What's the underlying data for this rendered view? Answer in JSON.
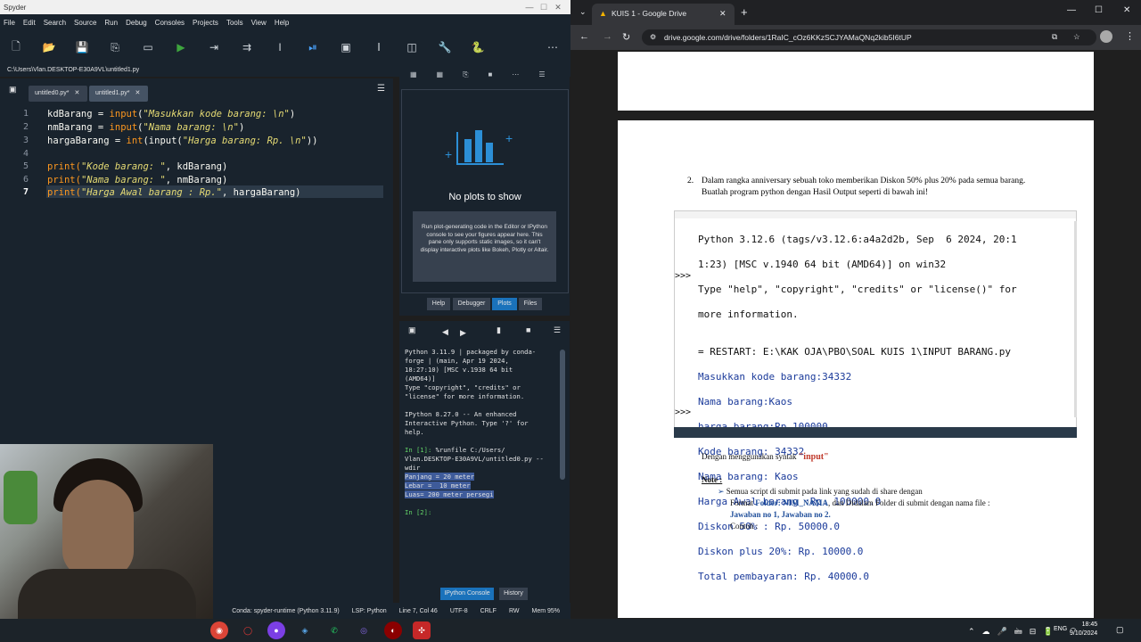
{
  "spyder": {
    "title": "Spyder",
    "window_controls": [
      "—",
      "☐",
      "✕"
    ],
    "menu": [
      "File",
      "Edit",
      "Search",
      "Source",
      "Run",
      "Debug",
      "Consoles",
      "Projects",
      "Tools",
      "View",
      "Help"
    ],
    "path": "C:\\Users\\Vlan.DESKTOP-E30A9VL\\untitled1.py",
    "tabs": [
      "untitled0.py*",
      "untitled1.py*"
    ],
    "line_numbers": [
      "1",
      "2",
      "3",
      "4",
      "5",
      "6",
      "7"
    ],
    "code": {
      "l1_a": "kdBarang = ",
      "l1_fn": "input",
      "l1_b": "(",
      "l1_str": "\"Masukkan kode barang: \\n\"",
      "l1_c": ")",
      "l2_a": "nmBarang = ",
      "l2_fn": "input",
      "l2_b": "(",
      "l2_str": "\"Nama barang: \\n\"",
      "l2_c": ")",
      "l3_a": "hargaBarang = ",
      "l3_fn": "int",
      "l3_b": "(input(",
      "l3_str": "\"Harga barang: Rp. \\n\"",
      "l3_c": "))",
      "l5_a": "print(",
      "l5_str": "\"Kode barang: \"",
      "l5_b": ", kdBarang)",
      "l6_a": "print(",
      "l6_str": "\"Nama barang: \"",
      "l6_b": ", nmBarang)",
      "l7_a": "print(",
      "l7_str": "\"Harga Awal barang : Rp.\"",
      "l7_b": ", hargaBarang)"
    },
    "plots": {
      "no_plots": "No plots to show",
      "info": "Run plot-generating code in the Editor or IPython console to see your figures appear here. This pane only supports static images, so it can't display interactive plots like Bokeh, Plotly or Altair.",
      "tabs": [
        "Help",
        "Debugger",
        "Plots",
        "Files"
      ]
    },
    "console": {
      "banner": "Python 3.11.9 | packaged by conda-\nforge | (main, Apr 19 2024,\n18:27:10) [MSC v.1938 64 bit\n(AMD64)]\nType \"copyright\", \"credits\" or\n\"license\" for more information.\n\nIPython 8.27.0 -- An enhanced\nInteractive Python. Type '?' for\nhelp.\n",
      "in1_prompt": "In [1]: ",
      "in1_cmd": "%runfile C:/Users/\nVlan.DESKTOP-E30A9VL/untitled0.py --\nwdir",
      "out_lines": [
        "Panjang = 20 meter",
        "Lebar =  10 meter",
        "Luas= 200 meter persegi"
      ],
      "in2_prompt": "In [2]:",
      "tabs": [
        "IPython Console",
        "History"
      ]
    },
    "status": {
      "conda": "Conda: spyder-runtime (Python 3.11.9)",
      "lsp": "LSP: Python",
      "pos": "Line 7, Col 46",
      "enc": "UTF-8",
      "eol": "CRLF",
      "rw": "RW",
      "mem": "Mem 95%"
    }
  },
  "chrome": {
    "tab_title": "KUIS 1 - Google Drive",
    "new_tab": "+",
    "url": "drive.google.com/drive/folders/1RaIC_cOz6KKzSCJYAMaQNq2kib5I6tUP",
    "window_controls": [
      "—",
      "☐",
      "✕"
    ]
  },
  "document": {
    "q_num": "2.",
    "q_text": "Dalam rangka anniversary sebuah toko memberikan Diskon 50% plus 20% pada semua barang. Buatlah program python dengan Hasil Output seperti di bawah ini!",
    "terminal_lines": [
      "Python 3.12.6 (tags/v3.12.6:a4a2d2b, Sep  6 2024, 20:1",
      "1:23) [MSC v.1940 64 bit (AMD64)] on win32",
      "Type \"help\", \"copyright\", \"credits\" or \"license()\" for",
      "more information.",
      "",
      "= RESTART: E:\\KAK OJA\\PBO\\SOAL KUIS 1\\INPUT BARANG.py",
      "Masukkan kode barang:34332",
      "Nama barang:Kaos",
      "harga barang:Rp.100000",
      "Kode barang: 34332",
      "Nama barang: Kaos",
      "Harga Awal barang :Rp. 100000.0",
      "Diskon 50% : Rp. 50000.0",
      "Diskon plus 20%: Rp. 10000.0",
      "Total pembayaran: Rp. 40000.0"
    ],
    "prompt": ">>>",
    "usage_a": "Dengan menggunakan syntak ",
    "usage_kw": "\"input\"",
    "note_label": "Note :",
    "note_line1": "Semua script di submit pada link yang sudah di share dengan",
    "note_line2a": "Format  ",
    "note_line2b": "Folder: NIM_NAMA",
    "note_line2c": ", dan Didalam Folder di submit  dengan nama file :",
    "note_line3": "Jawaban no 1, Jawaban no 2.",
    "note_line4": "Contoh :"
  },
  "taskbar": {
    "lang": "ENG",
    "time": "18:45",
    "date": "9/10/2024"
  }
}
